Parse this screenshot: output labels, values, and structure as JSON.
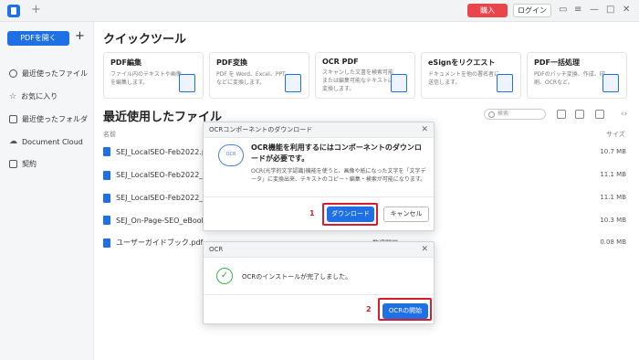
{
  "titlebar": {
    "buy": "購入",
    "login": "ログイン",
    "new_tab": "+"
  },
  "sidebar": {
    "open_pdf": "PDFを開く",
    "add": "+",
    "items": [
      {
        "label": "最近使ったファイル",
        "icon": "clock-icon"
      },
      {
        "label": "お気に入り",
        "icon": "star-icon"
      },
      {
        "label": "最近使ったフォルダ",
        "icon": "folder-icon"
      },
      {
        "label": "Document Cloud",
        "icon": "cloud-icon"
      },
      {
        "label": "契約",
        "icon": "contract-icon"
      }
    ]
  },
  "quick_tools": {
    "title": "クイックツール",
    "cards": [
      {
        "title": "PDF編集",
        "desc": "ファイル内のテキストや画像を編集します。"
      },
      {
        "title": "PDF変換",
        "desc": "PDF を Word、Excel、PPT などに変換します。"
      },
      {
        "title": "OCR PDF",
        "desc": "スキャンした文書を検索可能または編集可能なテキストに変換します。"
      },
      {
        "title": "eSignをリクエスト",
        "desc": "ドキュメントを他の署名者に送信します。"
      },
      {
        "title": "PDF一括処理",
        "desc": "PDFのバッチ変換、作成、印刷、OCRなど。"
      }
    ]
  },
  "recent": {
    "title": "最近使用したファイル",
    "search_placeholder": "検索",
    "col_name": "名前",
    "col_size": "サイズ",
    "files": [
      {
        "name": "SEJ_LocalSEO-Feb2022.pd",
        "size": "10.7 MB"
      },
      {
        "name": "SEJ_LocalSEO-Feb2022_通",
        "size": "11.1 MB"
      },
      {
        "name": "SEJ_LocalSEO-Feb2022_通",
        "size": "11.1 MB"
      },
      {
        "name": "SEJ_On-Page-SEO_eBook_",
        "size": "10.3 MB"
      },
      {
        "name": "ユーザーガイドブック.pdf",
        "size": "0.08 MB",
        "extra": "数週間前"
      }
    ]
  },
  "dialog_download": {
    "header": "OCRコンポーネントのダウンロード",
    "icon_label": "OCR",
    "heading": "OCR機能を利用するにはコンポーネントのダウンロードが必要です。",
    "body": "OCR(光学的文字認識)機能を使うと、画像や紙になった文字を「文字データ」に変換出来、テキストのコピー・編集・検索が可能になります。",
    "download": "ダウンロード",
    "cancel": "キャンセル",
    "step": "1"
  },
  "dialog_ocr": {
    "header": "OCR",
    "message": "OCRのインストールが完了しました。",
    "start": "OCRの開始",
    "step": "2"
  }
}
